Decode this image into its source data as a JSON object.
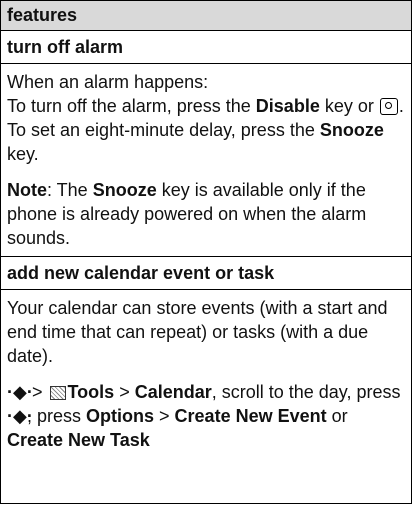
{
  "header": "features",
  "section1": {
    "title": "turn off alarm",
    "p1_line1": "When an alarm happens:",
    "p1_a": "To turn off the alarm, press the ",
    "p1_key1": "Disable",
    "p1_b": " key or ",
    "p1_c": ". To set an eight-minute delay, press the ",
    "p1_key2": "Snooze",
    "p1_d": " key.",
    "p2_note": "Note",
    "p2_a": ": The ",
    "p2_key": "Snooze",
    "p2_b": " key is available only if the phone is already powered on when the alarm sounds."
  },
  "section2": {
    "title": "add new calendar event or task",
    "p1": "Your calendar can store events (with a start and end time that can repeat) or tasks (with a due date).",
    "nav_glyph": "·◆·",
    "gt1": " > ",
    "tools": "Tools",
    "gt2": " > ",
    "calendar": "Calendar",
    "mid": ", scroll to the day, press ",
    "press_text": ", press ",
    "options": "Options",
    "gt3": " > ",
    "create_event": "Create New Event",
    "or_text": " or ",
    "create_task": "Create New Task"
  },
  "icons": {
    "power_key": "power-key-icon",
    "nav_key": "nav-key-icon",
    "tools": "tools-icon"
  }
}
